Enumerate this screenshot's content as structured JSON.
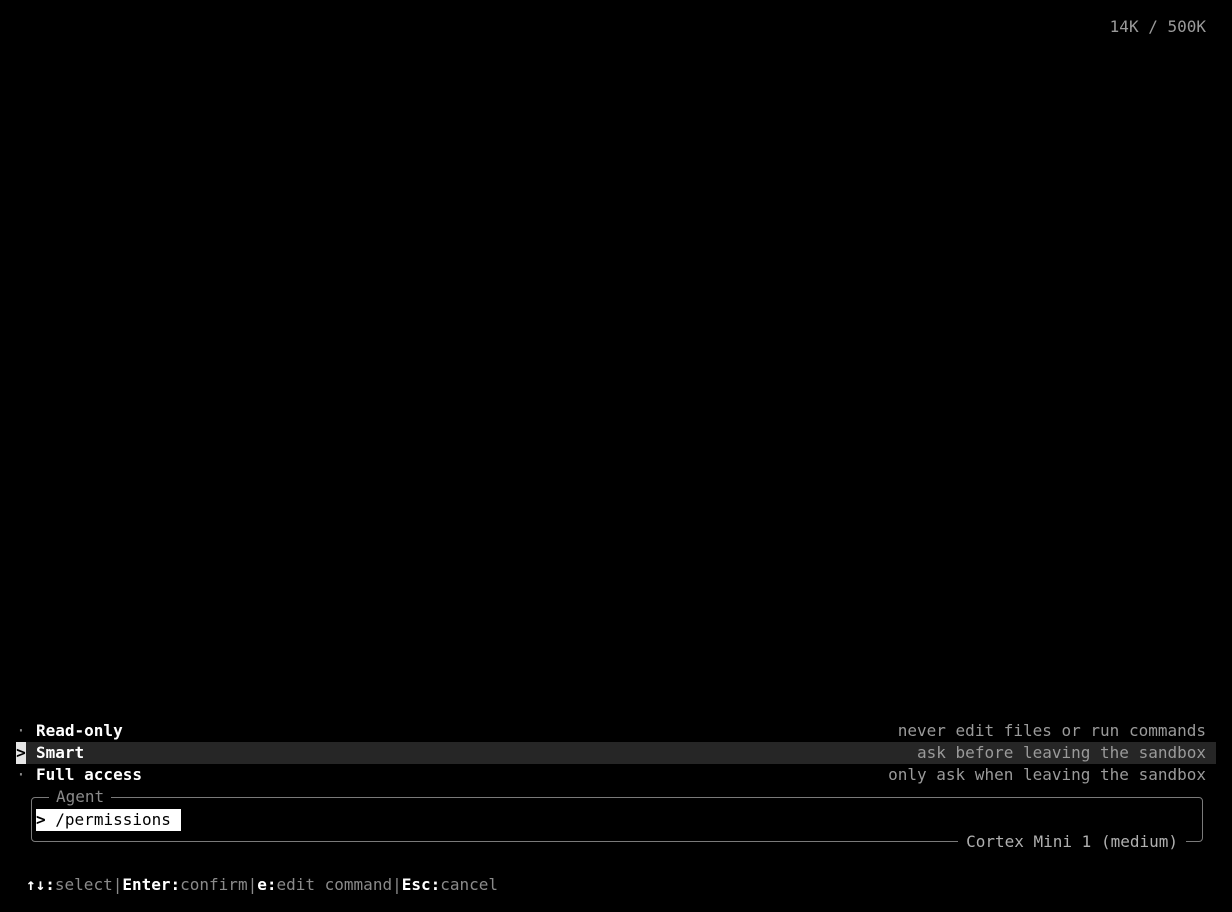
{
  "token_usage": "14K / 500K",
  "permission_options": [
    {
      "marker": "·",
      "label": "Read-only",
      "description": "never edit files or run commands",
      "selected": false
    },
    {
      "marker": ">",
      "label": "Smart",
      "description": "ask before leaving the sandbox",
      "selected": true
    },
    {
      "marker": "·",
      "label": "Full access",
      "description": "only ask when leaving the sandbox",
      "selected": false
    }
  ],
  "agent_box": {
    "legend": "Agent",
    "prompt_char": ">",
    "command": "/permissions",
    "model": "Cortex Mini 1 (medium)"
  },
  "hints": {
    "select_key": "↑↓:",
    "select_label": "select",
    "confirm_key": "Enter:",
    "confirm_label": "confirm",
    "edit_key": "e:",
    "edit_label": "edit command",
    "cancel_key": "Esc:",
    "cancel_label": "cancel",
    "separator": "|"
  }
}
